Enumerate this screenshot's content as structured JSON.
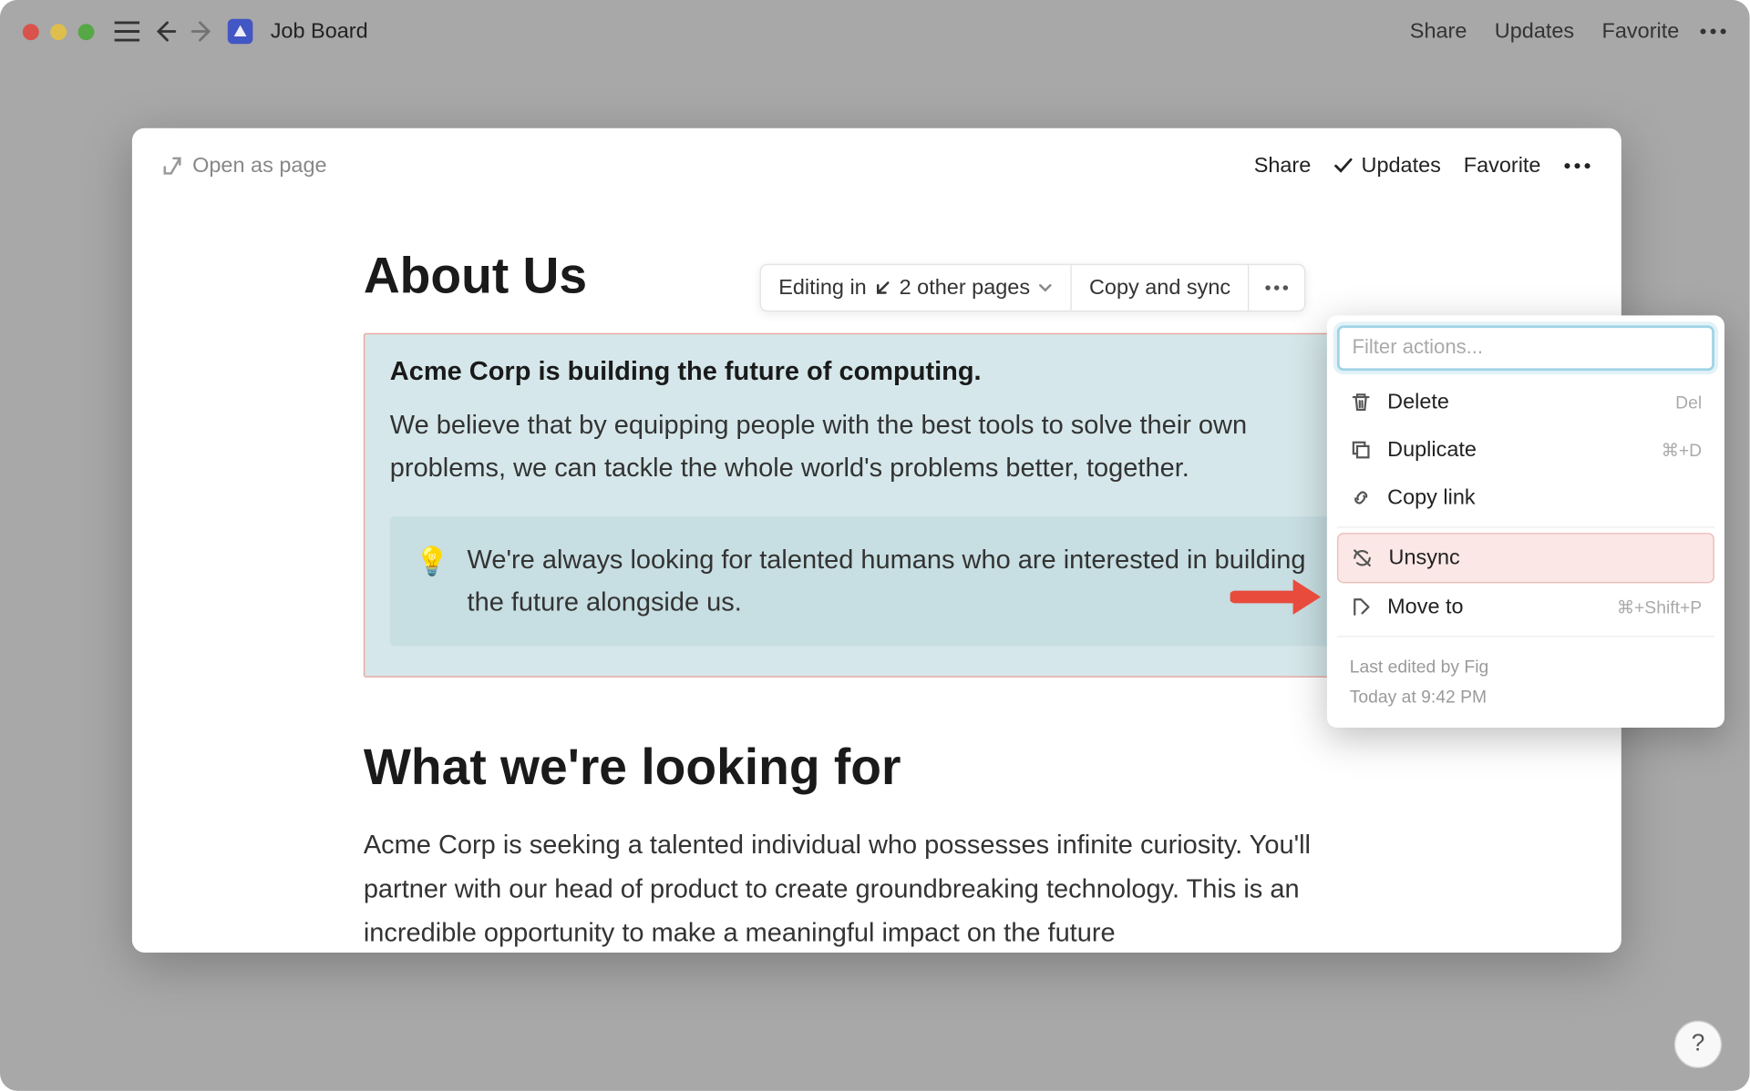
{
  "window": {
    "page_title": "Job Board"
  },
  "titlebar_actions": {
    "share": "Share",
    "updates": "Updates",
    "favorite": "Favorite"
  },
  "modal": {
    "open_as_page": "Open as page",
    "share": "Share",
    "updates": "Updates",
    "favorite": "Favorite"
  },
  "sync_toolbar": {
    "editing_in": "Editing in",
    "other_pages": "2 other pages",
    "copy_and_sync": "Copy and sync"
  },
  "about": {
    "heading": "About Us",
    "lead": "Acme Corp is building the future of computing.",
    "para": "We believe that by equipping people with the best tools to solve their own problems, we can tackle the whole world's problems better, together.",
    "callout": "We're always looking for talented humans who are interested in building the future alongside us."
  },
  "looking": {
    "heading": "What we're looking for",
    "para": "Acme Corp is seeking a talented individual who possesses infinite curiosity. You'll partner with our head of product to create groundbreaking technology. This is an incredible opportunity to make a meaningful impact on the future"
  },
  "menu": {
    "filter_placeholder": "Filter actions...",
    "delete": "Delete",
    "delete_kbd": "Del",
    "duplicate": "Duplicate",
    "duplicate_kbd": "⌘+D",
    "copy_link": "Copy link",
    "unsync": "Unsync",
    "move_to": "Move to",
    "move_to_kbd": "⌘+Shift+P",
    "last_edited": "Last edited by Fig",
    "timestamp": "Today at 9:42 PM"
  },
  "help": "?"
}
